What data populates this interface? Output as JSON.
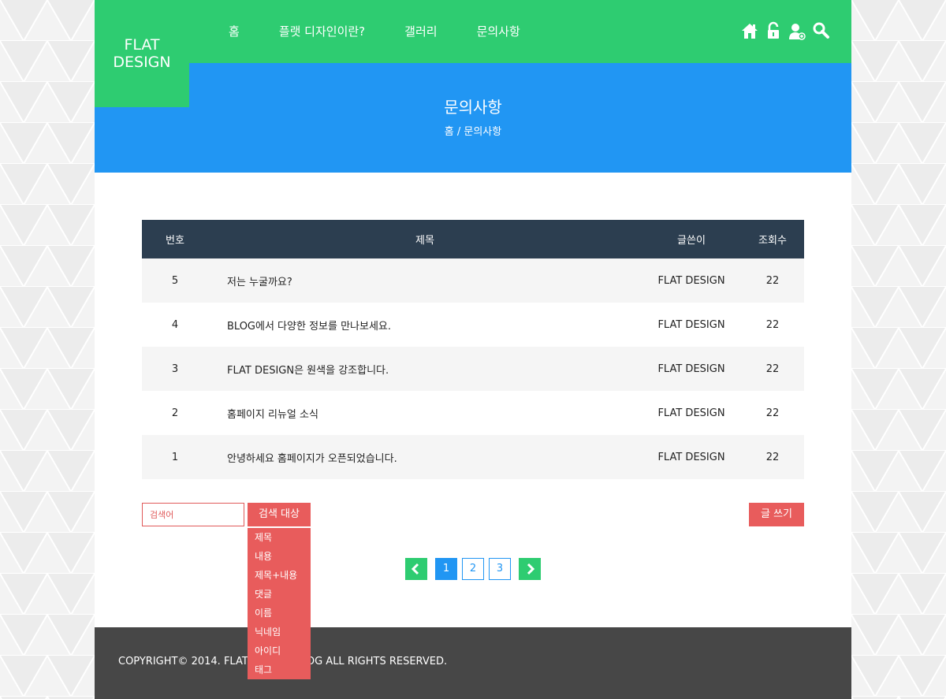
{
  "logo": {
    "line1": "FLAT",
    "line2": "DESIGN"
  },
  "nav": [
    {
      "label": "홈"
    },
    {
      "label": "플랫 디자인이란?"
    },
    {
      "label": "갤러리"
    },
    {
      "label": "문의사항"
    }
  ],
  "header_icons": [
    "home-icon",
    "unlock-icon",
    "user-add-icon",
    "search-icon"
  ],
  "hero": {
    "title": "문의사항",
    "breadcrumb": "홈 / 문의사항"
  },
  "table": {
    "headers": {
      "num": "번호",
      "title": "제목",
      "author": "글쓴이",
      "views": "조회수"
    },
    "rows": [
      {
        "num": "5",
        "title": "저는 누굴까요?",
        "author": "FLAT DESIGN",
        "views": "22"
      },
      {
        "num": "4",
        "title": "BLOG에서 다양한 정보를 만나보세요.",
        "author": "FLAT DESIGN",
        "views": "22"
      },
      {
        "num": "3",
        "title": "FLAT DESIGN은 원색을 강조합니다.",
        "author": "FLAT DESIGN",
        "views": "22"
      },
      {
        "num": "2",
        "title": "홈페이지 리뉴얼 소식",
        "author": "FLAT DESIGN",
        "views": "22"
      },
      {
        "num": "1",
        "title": "안녕하세요 홈페이지가 오픈되었습니다.",
        "author": "FLAT DESIGN",
        "views": "22"
      }
    ]
  },
  "search": {
    "placeholder": "검색어",
    "target_label": "검색 대상",
    "options": [
      "제목",
      "내용",
      "제목+내용",
      "댓글",
      "이름",
      "닉네임",
      "아이디",
      "태그"
    ]
  },
  "write_label": "글 쓰기",
  "pagination": {
    "prev": "‹",
    "next": "›",
    "pages": [
      "1",
      "2",
      "3"
    ],
    "current": "1"
  },
  "footer": {
    "text": "COPYRIGHT© 2014. FLAT DESIGN BLOG ALL RIGHTS RESERVED."
  },
  "colors": {
    "green": "#2ecc71",
    "blue": "#2196f3",
    "navy": "#2c3e50",
    "red": "#e85c5c",
    "footer": "#474747"
  }
}
